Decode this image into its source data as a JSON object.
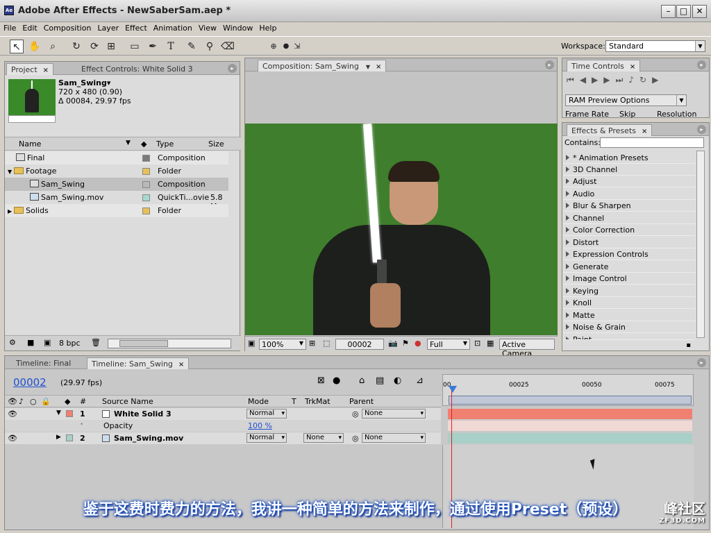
{
  "window": {
    "title": "Adobe After Effects - NewSaberSam.aep *",
    "min": "–",
    "max": "□",
    "close": "✕"
  },
  "menu": [
    "File",
    "Edit",
    "Composition",
    "Layer",
    "Effect",
    "Animation",
    "View",
    "Window",
    "Help"
  ],
  "workspace": {
    "label": "Workspace:",
    "value": "Standard"
  },
  "project": {
    "tab1": "Project",
    "tab2": "Effect Controls: White Solid 3",
    "item_name": "Sam_Swing▾",
    "item_dims": "720 x 480 (0.90)",
    "item_dur": "Δ 00084, 29.97 fps",
    "columns": {
      "name": "Name",
      "type": "Type",
      "size": "Size"
    },
    "rows": [
      {
        "name": "Final",
        "type": "Composition",
        "size": "",
        "swatch": "#7a7a7a"
      },
      {
        "name": "Footage",
        "type": "Folder",
        "size": "",
        "swatch": "#e8c058"
      },
      {
        "name": "Sam_Swing",
        "type": "Composition",
        "size": "",
        "swatch": "#b8b8b8"
      },
      {
        "name": "Sam_Swing.mov",
        "type": "QuickTi...ovie",
        "size": "5.8 M",
        "swatch": "#a8d8d0"
      },
      {
        "name": "Solids",
        "type": "Folder",
        "size": "",
        "swatch": "#e8c058"
      }
    ],
    "bpc": "8 bpc"
  },
  "composition": {
    "tab": "Composition: Sam_Swing",
    "zoom": "100%",
    "frame": "00002",
    "resolution": "Full",
    "camera": "Active Camera"
  },
  "time_controls": {
    "tab": "Time Controls",
    "ram_preview": "RAM Preview Options",
    "labels": [
      "Frame Rate",
      "Skip",
      "Resolution"
    ]
  },
  "effects": {
    "tab": "Effects & Presets",
    "contains": "Contains:",
    "items": [
      "* Animation Presets",
      "3D Channel",
      "Adjust",
      "Audio",
      "Blur & Sharpen",
      "Channel",
      "Color Correction",
      "Distort",
      "Expression Controls",
      "Generate",
      "Image Control",
      "Keying",
      "Knoll",
      "Matte",
      "Noise & Grain",
      "Paint"
    ]
  },
  "timeline": {
    "tab1": "Timeline: Final",
    "tab2": "Timeline: Sam_Swing",
    "timecode": "00002",
    "fps": "(29.97 fps)",
    "headers": {
      "num": "#",
      "source": "Source Name",
      "mode": "Mode",
      "t": "T",
      "trkmat": "TrkMat",
      "parent": "Parent"
    },
    "ruler": [
      "00",
      "00025",
      "00050",
      "00075"
    ],
    "layers": [
      {
        "num": "1",
        "name": "White Solid 3",
        "mode": "Normal",
        "trkmat": "",
        "parent": "None",
        "color": "#f08070"
      },
      {
        "num": "2",
        "name": "Sam_Swing.mov",
        "mode": "Normal",
        "trkmat": "None",
        "parent": "None",
        "color": "#a8d0c8"
      }
    ],
    "opacity_label": "Opacity",
    "opacity_value": "100 %"
  },
  "subtitle": "鉴于这费时费力的方法，我讲一种简单的方法来制作，通过使用Preset（预设）",
  "watermark": {
    "main": "峰社区",
    "sub": "ZF3D.COM"
  }
}
